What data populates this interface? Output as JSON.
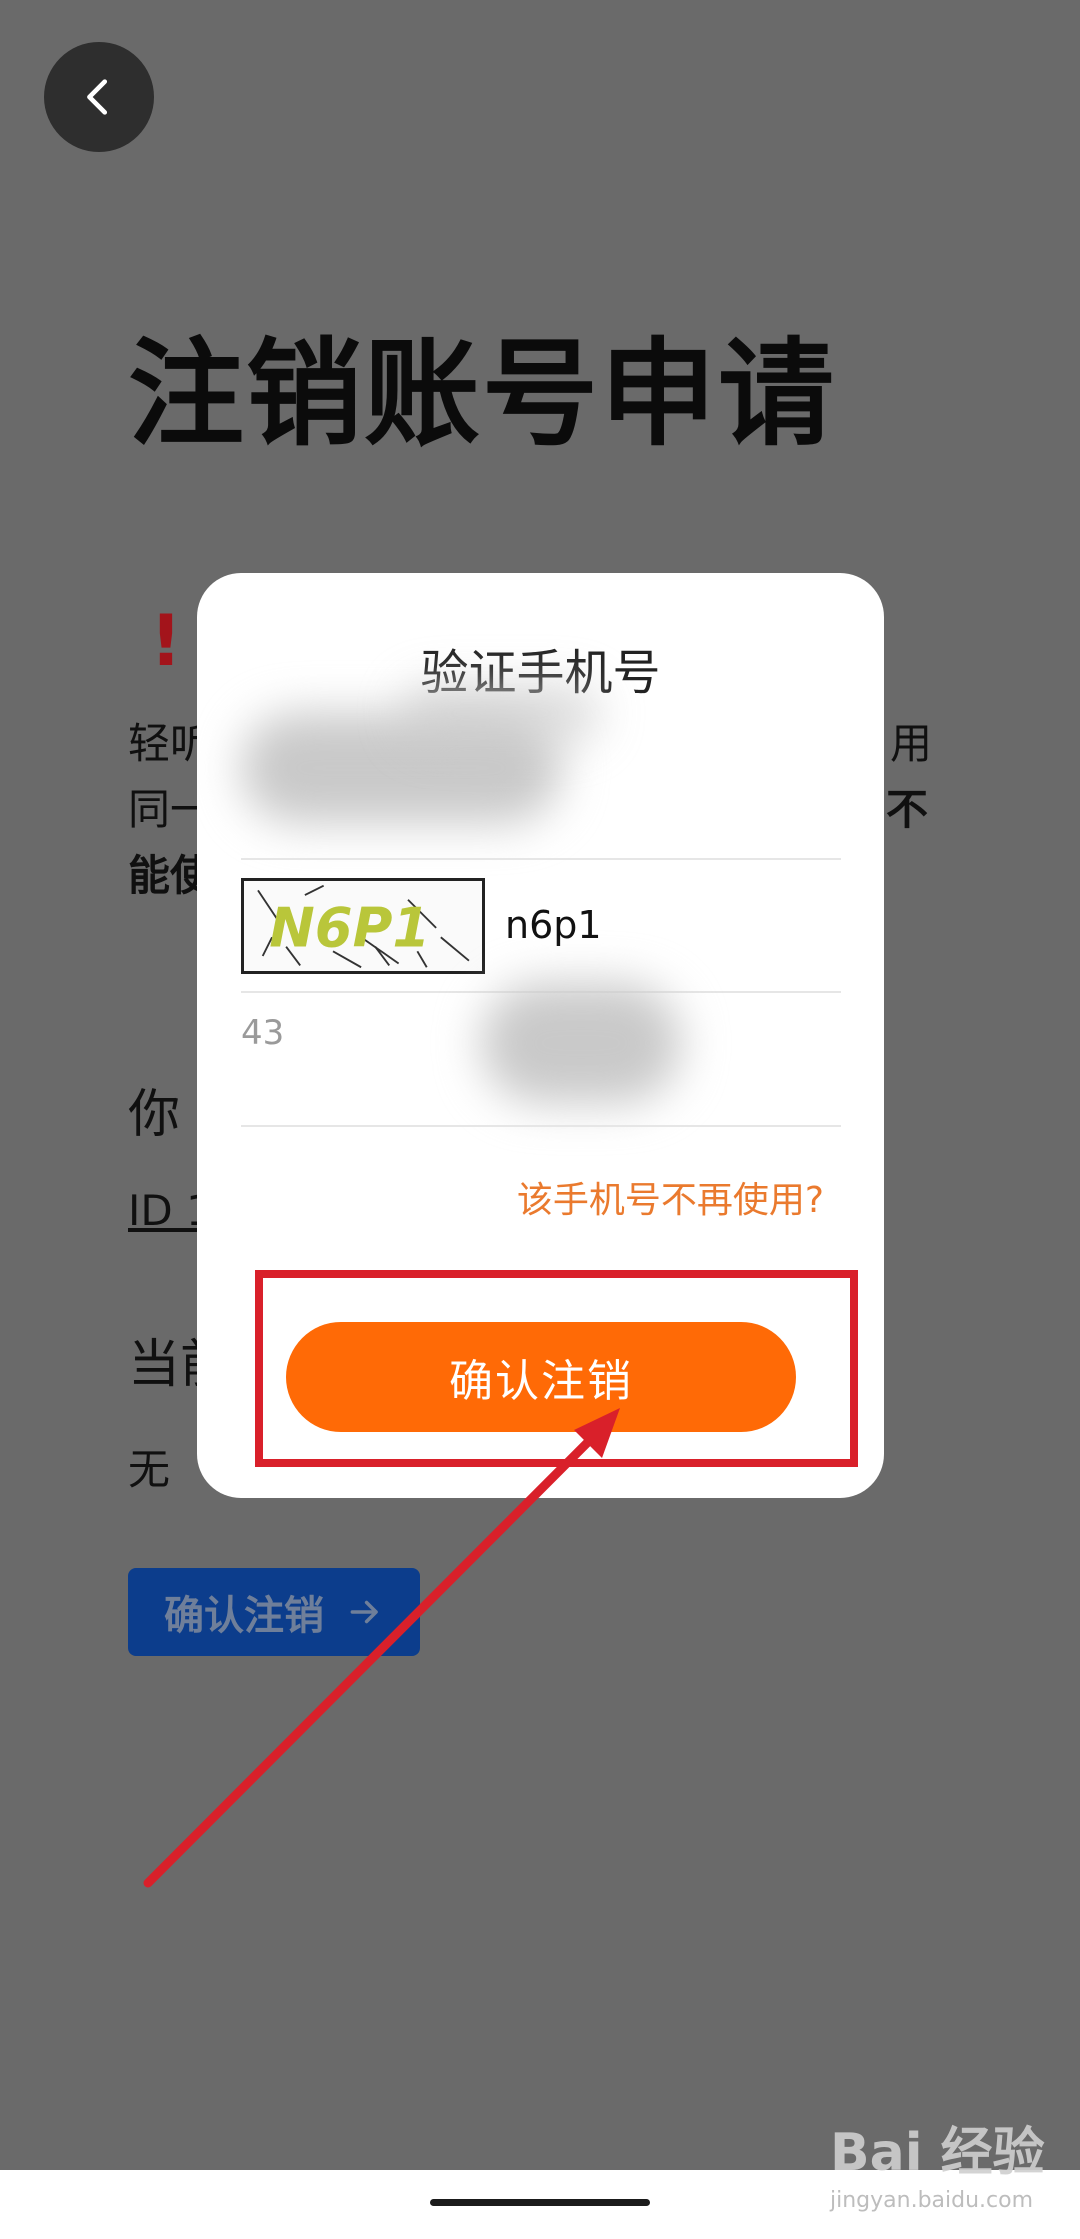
{
  "background_page": {
    "title": "注销账号申请",
    "line1_left": "轻听",
    "line1_right": "用",
    "line2_left": "同一",
    "line2_right": "不",
    "line3_left": "能使",
    "section1_label": "你",
    "id_prefix": "ID 1",
    "section2_label": "当前",
    "section2_value": "无",
    "confirm_button": "确认注销"
  },
  "dialog": {
    "title": "验证手机号",
    "captcha_text": "N6P1",
    "captcha_input_value": "n6p1",
    "sms_code_value": "43",
    "phone_not_used_link": "该手机号不再使用?",
    "confirm_button": "确认注销"
  },
  "watermark": {
    "brand": "Bai 经验",
    "url": "jingyan.baidu.com"
  },
  "colors": {
    "accent": "#ff6a06",
    "link": "#ea7a2e",
    "highlight": "#d9202a",
    "overlay": "#6a6a6a"
  }
}
